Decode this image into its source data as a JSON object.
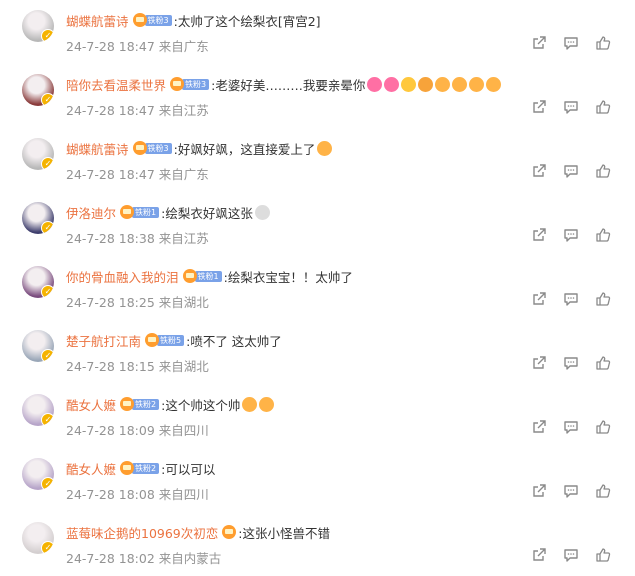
{
  "comments": [
    {
      "name": "蝴蝶航蕾诗",
      "fan_level": "铁粉3",
      "text": ":太帅了这个绘梨衣[宵宫2]",
      "time": "24-7-28 18:47",
      "location": "来自广东",
      "avatar_color": "#b8b8b8",
      "emojis": []
    },
    {
      "name": "陪你去看温柔世界",
      "fan_level": "铁粉3",
      "text": ":老婆好美………我要亲晕你",
      "time": "24-7-28 18:47",
      "location": "来自江苏",
      "avatar_color": "#8a3b3b",
      "emojis": [
        "#ff6fa4",
        "#ff6fa4",
        "#ffc83d",
        "#f7a33a",
        "#ffb347",
        "#ffb347",
        "#ffb347",
        "#ffb347"
      ]
    },
    {
      "name": "蝴蝶航蕾诗",
      "fan_level": "铁粉3",
      "text": ":好飒好飒，这直接爱上了",
      "time": "24-7-28 18:47",
      "location": "来自广东",
      "avatar_color": "#b8b8b8",
      "emojis": [
        "#ffb347"
      ]
    },
    {
      "name": "伊洛迪尔",
      "fan_level": "铁粉1",
      "text": ":绘梨衣好飒这张",
      "time": "24-7-28 18:38",
      "location": "来自江苏",
      "avatar_color": "#3f3f6e",
      "emojis": [
        "#dddddd"
      ]
    },
    {
      "name": "你的骨血融入我的泪",
      "fan_level": "铁粉1",
      "text": ":绘梨衣宝宝！！太帅了",
      "time": "24-7-28 18:25",
      "location": "来自湖北",
      "avatar_color": "#7a4c7e",
      "emojis": []
    },
    {
      "name": "楚子航打江南",
      "fan_level": "铁粉5",
      "text": ":喷不了 这太帅了",
      "time": "24-7-28 18:15",
      "location": "来自湖北",
      "avatar_color": "#9aa7b8",
      "emojis": []
    },
    {
      "name": "酷女人嬷",
      "fan_level": "铁粉2",
      "text": ":这个帅这个帅",
      "time": "24-7-28 18:09",
      "location": "来自四川",
      "avatar_color": "#b7a5c9",
      "emojis": [
        "#ffb347",
        "#ffb347"
      ]
    },
    {
      "name": "酷女人嬷",
      "fan_level": "铁粉2",
      "text": ":可以可以",
      "time": "24-7-28 18:08",
      "location": "来自四川",
      "avatar_color": "#b7a5c9",
      "emojis": []
    },
    {
      "name": "蓝莓味企鹅的10969次初恋",
      "fan_level": "",
      "text": ":这张小怪兽不错",
      "time": "24-7-28 18:02",
      "location": "来自内蒙古",
      "avatar_color": "#d4cfd0",
      "emojis": []
    }
  ]
}
